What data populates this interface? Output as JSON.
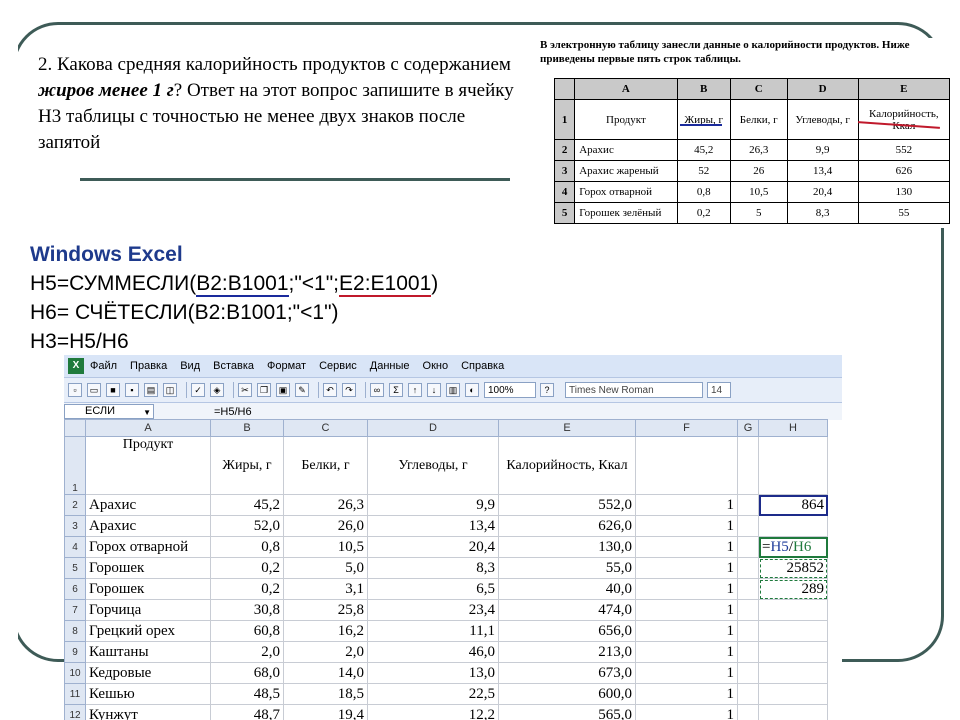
{
  "question": {
    "prefix": "2. Какова средняя калорийность продуктов с содержанием ",
    "emphasis": "жиров менее 1 г",
    "suffix": "? Ответ на этот вопрос запишите в ячейку H3 таблицы с точностью не менее двух знаков после запятой"
  },
  "mini_table": {
    "caption": "В электронную таблицу занесли данные о калорийности продуктов. Ниже приведены первые пять строк таблицы.",
    "col_headers": [
      "A",
      "B",
      "C",
      "D",
      "E"
    ],
    "header_row": {
      "num": "1",
      "cells": [
        "Продукт",
        "Жиры, г",
        "Белки, г",
        "Углеводы, г",
        "Калорийность, Ккал"
      ]
    },
    "rows": [
      {
        "num": "2",
        "cells": [
          "Арахис",
          "45,2",
          "26,3",
          "9,9",
          "552"
        ]
      },
      {
        "num": "3",
        "cells": [
          "Арахис жареный",
          "52",
          "26",
          "13,4",
          "626"
        ]
      },
      {
        "num": "4",
        "cells": [
          "Горох отварной",
          "0,8",
          "10,5",
          "20,4",
          "130"
        ]
      },
      {
        "num": "5",
        "cells": [
          "Горошек зелёный",
          "0,2",
          "5",
          "8,3",
          "55"
        ]
      }
    ]
  },
  "formulas": {
    "title": "Windows Excel",
    "line1": {
      "a": "H5=СУММЕСЛИ(",
      "b": "B2:B1001",
      "c": ";\"<1\";",
      "d": "E2:E1001",
      "e": ")"
    },
    "line2": "H6= СЧЁТЕСЛИ(B2:B1001;\"<1\")",
    "line3": "H3=H5/H6"
  },
  "excel": {
    "menu": [
      "Файл",
      "Правка",
      "Вид",
      "Вставка",
      "Формат",
      "Сервис",
      "Данные",
      "Окно",
      "Справка"
    ],
    "zoom": "100%",
    "font": "Times New Roman",
    "font_size": "14",
    "name_box": "ЕСЛИ",
    "formula": "=H5/H6",
    "col_headers": [
      "A",
      "B",
      "C",
      "D",
      "E",
      "F",
      "G",
      "H"
    ],
    "header": {
      "num": "1",
      "product": "Продукт",
      "fat": "Жиры, г",
      "protein": "Белки, г",
      "carbs": "Углеводы, г",
      "cal": "Калорийность, Ккал"
    },
    "rows": [
      {
        "num": "2",
        "product": "Арахис",
        "fat": "45,2",
        "protein": "26,3",
        "carbs": "9,9",
        "cal": "552,0",
        "f": "1",
        "h": "864"
      },
      {
        "num": "3",
        "product": "Арахис",
        "fat": "52,0",
        "protein": "26,0",
        "carbs": "13,4",
        "cal": "626,0",
        "f": "1",
        "h": ""
      },
      {
        "num": "4",
        "product": "Горох отварной",
        "fat": "0,8",
        "protein": "10,5",
        "carbs": "20,4",
        "cal": "130,0",
        "f": "1",
        "h": ""
      },
      {
        "num": "5",
        "product": "Горошек",
        "fat": "0,2",
        "protein": "5,0",
        "carbs": "8,3",
        "cal": "55,0",
        "f": "1",
        "h": "25852"
      },
      {
        "num": "6",
        "product": "Горошек",
        "fat": "0,2",
        "protein": "3,1",
        "carbs": "6,5",
        "cal": "40,0",
        "f": "1",
        "h": "289"
      },
      {
        "num": "7",
        "product": "Горчица",
        "fat": "30,8",
        "protein": "25,8",
        "carbs": "23,4",
        "cal": "474,0",
        "f": "1",
        "h": ""
      },
      {
        "num": "8",
        "product": "Грецкий орех",
        "fat": "60,8",
        "protein": "16,2",
        "carbs": "11,1",
        "cal": "656,0",
        "f": "1",
        "h": ""
      },
      {
        "num": "9",
        "product": "Каштаны",
        "fat": "2,0",
        "protein": "2,0",
        "carbs": "46,0",
        "cal": "213,0",
        "f": "1",
        "h": ""
      },
      {
        "num": "10",
        "product": "Кедровые",
        "fat": "68,0",
        "protein": "14,0",
        "carbs": "13,0",
        "cal": "673,0",
        "f": "1",
        "h": ""
      },
      {
        "num": "11",
        "product": "Кешью",
        "fat": "48,5",
        "protein": "18,5",
        "carbs": "22,5",
        "cal": "600,0",
        "f": "1",
        "h": ""
      },
      {
        "num": "12",
        "product": "Кунжут",
        "fat": "48,7",
        "protein": "19,4",
        "carbs": "12,2",
        "cal": "565,0",
        "f": "1",
        "h": ""
      }
    ]
  },
  "colors": {
    "frame": "#3e5b57",
    "blue_underline": "#1a2a9c",
    "red_underline": "#c0192b",
    "title": "#1e3a8c"
  }
}
